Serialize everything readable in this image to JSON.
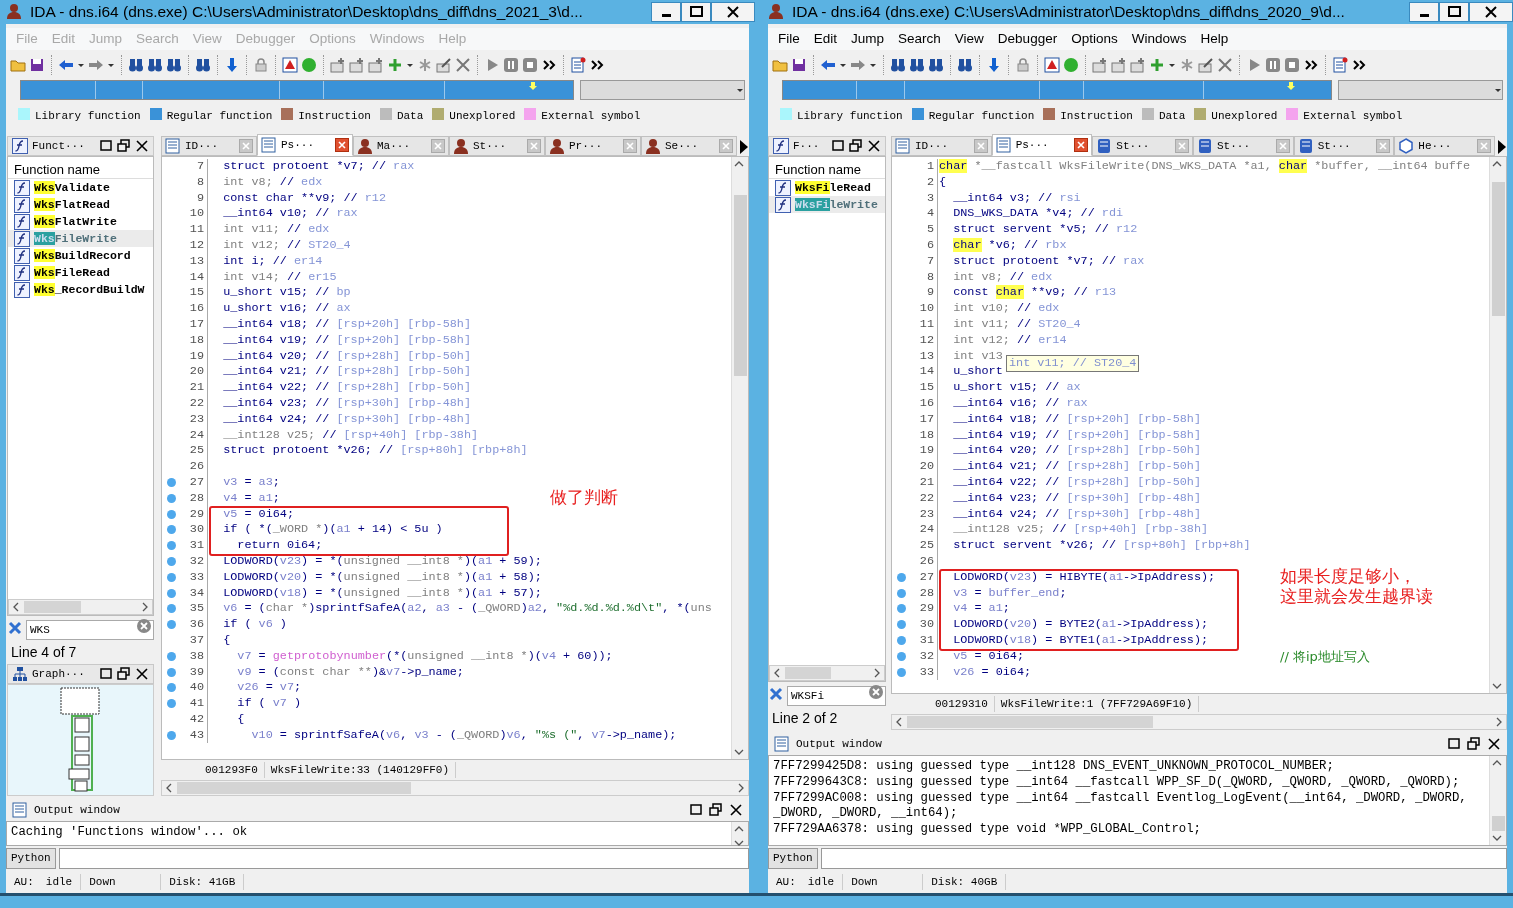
{
  "windows": [
    {
      "title": "IDA - dns.i64 (dns.exe) C:\\Users\\Administrator\\Desktop\\dns_diff\\dns_2021_3\\d...",
      "menu": [
        {
          "label": "File",
          "disabled": true
        },
        {
          "label": "Edit",
          "disabled": true
        },
        {
          "label": "Jump",
          "disabled": true
        },
        {
          "label": "Search",
          "disabled": true
        },
        {
          "label": "View",
          "disabled": true
        },
        {
          "label": "Debugger",
          "disabled": true
        },
        {
          "label": "Options",
          "disabled": true
        },
        {
          "label": "Windows",
          "disabled": true
        },
        {
          "label": "Help",
          "disabled": true
        }
      ],
      "legend": [
        {
          "label": "Library function",
          "color": "#aaf6fc"
        },
        {
          "label": "Regular function",
          "color": "#3a92d8"
        },
        {
          "label": "Instruction",
          "color": "#a8705a"
        },
        {
          "label": "Data",
          "color": "#bcbcbc"
        },
        {
          "label": "Unexplored",
          "color": "#b0ac70"
        },
        {
          "label": "External symbol",
          "color": "#f4a4ee"
        }
      ],
      "functions_panel": {
        "title": "Funct···",
        "column": "Function name",
        "filter": "WKS",
        "line_info": "Line 4 of 7",
        "items": [
          {
            "match": "Wks",
            "rest": "Validate",
            "selected": false
          },
          {
            "match": "Wks",
            "rest": "FlatRead",
            "selected": false
          },
          {
            "match": "Wks",
            "rest": "FlatWrite",
            "selected": false
          },
          {
            "match": "Wks",
            "rest": "FileWrite",
            "selected": true
          },
          {
            "match": "Wks",
            "rest": "BuildRecord",
            "selected": false
          },
          {
            "match": "Wks",
            "rest": "FileRead",
            "selected": false
          },
          {
            "match": "Wks",
            "rest": "_RecordBuildW",
            "selected": false
          }
        ]
      },
      "graph_panel": {
        "title": "Graph···"
      },
      "tabs": [
        {
          "label": "ID···",
          "kind": "listing",
          "selected": false
        },
        {
          "label": "Ps···",
          "kind": "listing",
          "selected": true
        },
        {
          "label": "Ma···",
          "kind": "portrait",
          "selected": false
        },
        {
          "label": "St···",
          "kind": "portrait",
          "selected": false
        },
        {
          "label": "Pr···",
          "kind": "portrait",
          "selected": false
        },
        {
          "label": "Se···",
          "kind": "portrait",
          "selected": false
        }
      ],
      "code": {
        "address": "001293F0",
        "location": "WksFileWrite:33 (140129FF0)",
        "lines": [
          {
            "num": "7",
            "bp": false,
            "tokens": [
              {
                "kind": "code",
                "text": "  struct protoent *v7; // "
              },
              {
                "kind": "cmt",
                "text": "rax"
              }
            ]
          },
          {
            "num": "8",
            "bp": false,
            "tokens": [
              {
                "kind": "dim",
                "text": "  int v8; "
              },
              {
                "kind": "code",
                "text": "// "
              },
              {
                "kind": "cmt",
                "text": "edx"
              }
            ]
          },
          {
            "num": "9",
            "bp": false,
            "tokens": [
              {
                "kind": "code",
                "text": "  const char **v9; // "
              },
              {
                "kind": "cmt",
                "text": "r12"
              }
            ]
          },
          {
            "num": "10",
            "bp": false,
            "tokens": [
              {
                "kind": "code",
                "text": "  __int64 v10; // "
              },
              {
                "kind": "cmt",
                "text": "rax"
              }
            ]
          },
          {
            "num": "11",
            "bp": false,
            "tokens": [
              {
                "kind": "dim",
                "text": "  int v11; "
              },
              {
                "kind": "code",
                "text": "// "
              },
              {
                "kind": "cmt",
                "text": "edx"
              }
            ]
          },
          {
            "num": "12",
            "bp": false,
            "tokens": [
              {
                "kind": "dim",
                "text": "  int v12; "
              },
              {
                "kind": "code",
                "text": "// "
              },
              {
                "kind": "cmt",
                "text": "ST20_4"
              }
            ]
          },
          {
            "num": "13",
            "bp": false,
            "tokens": [
              {
                "kind": "code",
                "text": "  int i; // "
              },
              {
                "kind": "cmt",
                "text": "er14"
              }
            ]
          },
          {
            "num": "14",
            "bp": false,
            "tokens": [
              {
                "kind": "dim",
                "text": "  int v14; "
              },
              {
                "kind": "code",
                "text": "// "
              },
              {
                "kind": "cmt",
                "text": "er15"
              }
            ]
          },
          {
            "num": "15",
            "bp": false,
            "tokens": [
              {
                "kind": "code",
                "text": "  u_short v15; // "
              },
              {
                "kind": "cmt",
                "text": "bp"
              }
            ]
          },
          {
            "num": "16",
            "bp": false,
            "tokens": [
              {
                "kind": "code",
                "text": "  u_short v16; // "
              },
              {
                "kind": "cmt",
                "text": "ax"
              }
            ]
          },
          {
            "num": "17",
            "bp": false,
            "tokens": [
              {
                "kind": "code",
                "text": "  __int64 v18; // "
              },
              {
                "kind": "cmt",
                "text": "[rsp+20h] [rbp-58h]"
              }
            ]
          },
          {
            "num": "18",
            "bp": false,
            "tokens": [
              {
                "kind": "code",
                "text": "  __int64 v19; // "
              },
              {
                "kind": "cmt",
                "text": "[rsp+20h] [rbp-58h]"
              }
            ]
          },
          {
            "num": "19",
            "bp": false,
            "tokens": [
              {
                "kind": "code",
                "text": "  __int64 v20; // "
              },
              {
                "kind": "cmt",
                "text": "[rsp+28h] [rbp-50h]"
              }
            ]
          },
          {
            "num": "20",
            "bp": false,
            "tokens": [
              {
                "kind": "code",
                "text": "  __int64 v21; // "
              },
              {
                "kind": "cmt",
                "text": "[rsp+28h] [rbp-50h]"
              }
            ]
          },
          {
            "num": "21",
            "bp": false,
            "tokens": [
              {
                "kind": "code",
                "text": "  __int64 v22; // "
              },
              {
                "kind": "cmt",
                "text": "[rsp+28h] [rbp-50h]"
              }
            ]
          },
          {
            "num": "22",
            "bp": false,
            "tokens": [
              {
                "kind": "code",
                "text": "  __int64 v23; // "
              },
              {
                "kind": "cmt",
                "text": "[rsp+30h] [rbp-48h]"
              }
            ]
          },
          {
            "num": "23",
            "bp": false,
            "tokens": [
              {
                "kind": "code",
                "text": "  __int64 v24; // "
              },
              {
                "kind": "cmt",
                "text": "[rsp+30h] [rbp-48h]"
              }
            ]
          },
          {
            "num": "24",
            "bp": false,
            "tokens": [
              {
                "kind": "dim",
                "text": "  __int128 v25; "
              },
              {
                "kind": "code",
                "text": "// "
              },
              {
                "kind": "cmt",
                "text": "[rsp+40h] [rbp-38h]"
              }
            ]
          },
          {
            "num": "25",
            "bp": false,
            "tokens": [
              {
                "kind": "code",
                "text": "  struct protoent *v26; // "
              },
              {
                "kind": "cmt",
                "text": "[rsp+80h] [rbp+8h]"
              }
            ]
          },
          {
            "num": "26",
            "bp": false
          },
          {
            "num": "27",
            "bp": true,
            "tokens": [
              {
                "kind": "var",
                "text": "  v3"
              },
              {
                "kind": "code",
                "text": " = "
              },
              {
                "kind": "var",
                "text": "a3"
              },
              {
                "kind": "code",
                "text": ";"
              }
            ]
          },
          {
            "num": "28",
            "bp": true,
            "note": {
              "kind": "callout",
              "lines": [
                "做了判断"
              ]
            },
            "tokens": [
              {
                "kind": "var",
                "text": "  v4"
              },
              {
                "kind": "code",
                "text": " = "
              },
              {
                "kind": "var",
                "text": "a1"
              },
              {
                "kind": "code",
                "text": ";"
              }
            ]
          },
          {
            "num": "29",
            "bp": true,
            "boxed": true,
            "tokens": [
              {
                "kind": "var",
                "text": "  v5"
              },
              {
                "kind": "code",
                "text": " = 0i64;"
              }
            ]
          },
          {
            "num": "30",
            "bp": true,
            "boxed": true,
            "tokens": [
              {
                "kind": "code",
                "text": "  if ( *("
              },
              {
                "kind": "dim",
                "text": "_WORD *"
              },
              {
                "kind": "code",
                "text": ")("
              },
              {
                "kind": "var",
                "text": "a1"
              },
              {
                "kind": "code",
                "text": " + 14) < 5u )"
              }
            ]
          },
          {
            "num": "31",
            "bp": true,
            "boxed": true,
            "tokens": [
              {
                "kind": "code",
                "text": "    return 0i64;"
              }
            ]
          },
          {
            "num": "32",
            "bp": true,
            "tokens": [
              {
                "kind": "code",
                "text": "  LODWORD("
              },
              {
                "kind": "var",
                "text": "v23"
              },
              {
                "kind": "code",
                "text": ") = *("
              },
              {
                "kind": "dim",
                "text": "unsigned __int8 *"
              },
              {
                "kind": "code",
                "text": ")("
              },
              {
                "kind": "var",
                "text": "a1"
              },
              {
                "kind": "code",
                "text": " + 59);"
              }
            ]
          },
          {
            "num": "33",
            "bp": true,
            "tokens": [
              {
                "kind": "code",
                "text": "  LODWORD("
              },
              {
                "kind": "var",
                "text": "v20"
              },
              {
                "kind": "code",
                "text": ") = *("
              },
              {
                "kind": "dim",
                "text": "unsigned __int8 *"
              },
              {
                "kind": "code",
                "text": ")("
              },
              {
                "kind": "var",
                "text": "a1"
              },
              {
                "kind": "code",
                "text": " + 58);"
              }
            ]
          },
          {
            "num": "34",
            "bp": true,
            "tokens": [
              {
                "kind": "code",
                "text": "  LODWORD("
              },
              {
                "kind": "var",
                "text": "v18"
              },
              {
                "kind": "code",
                "text": ") = *("
              },
              {
                "kind": "dim",
                "text": "unsigned __int8 *"
              },
              {
                "kind": "code",
                "text": ")("
              },
              {
                "kind": "var",
                "text": "a1"
              },
              {
                "kind": "code",
                "text": " + 57);"
              }
            ]
          },
          {
            "num": "35",
            "bp": true,
            "tokens": [
              {
                "kind": "var",
                "text": "  v6"
              },
              {
                "kind": "code",
                "text": " = ("
              },
              {
                "kind": "dim",
                "text": "char *"
              },
              {
                "kind": "code",
                "text": ")sprintfSafeA("
              },
              {
                "kind": "var",
                "text": "a2"
              },
              {
                "kind": "code",
                "text": ", "
              },
              {
                "kind": "var",
                "text": "a3"
              },
              {
                "kind": "code",
                "text": " - ("
              },
              {
                "kind": "dim",
                "text": "_QWORD"
              },
              {
                "kind": "code",
                "text": ")"
              },
              {
                "kind": "var",
                "text": "a2"
              },
              {
                "kind": "code",
                "text": ", "
              },
              {
                "kind": "str",
                "text": "\"%d.%d.%d.%d\\t\""
              },
              {
                "kind": "code",
                "text": ", *("
              },
              {
                "kind": "dim",
                "text": "uns"
              }
            ]
          },
          {
            "num": "36",
            "bp": true,
            "tokens": [
              {
                "kind": "code",
                "text": "  if ( "
              },
              {
                "kind": "var",
                "text": "v6"
              },
              {
                "kind": "code",
                "text": " )"
              }
            ]
          },
          {
            "num": "37",
            "bp": false,
            "tokens": [
              {
                "kind": "code",
                "text": "  {"
              }
            ]
          },
          {
            "num": "38",
            "bp": true,
            "tokens": [
              {
                "kind": "var",
                "text": "    v7"
              },
              {
                "kind": "code",
                "text": " = "
              },
              {
                "kind": "fn",
                "text": "getprotobynumber"
              },
              {
                "kind": "code",
                "text": "(*("
              },
              {
                "kind": "dim",
                "text": "unsigned __int8 *"
              },
              {
                "kind": "code",
                "text": ")("
              },
              {
                "kind": "var",
                "text": "v4"
              },
              {
                "kind": "code",
                "text": " + 60));"
              }
            ]
          },
          {
            "num": "39",
            "bp": true,
            "tokens": [
              {
                "kind": "var",
                "text": "    v9"
              },
              {
                "kind": "code",
                "text": " = ("
              },
              {
                "kind": "dim",
                "text": "const char **"
              },
              {
                "kind": "code",
                "text": ")&"
              },
              {
                "kind": "var",
                "text": "v7"
              },
              {
                "kind": "code",
                "text": "->p_name;"
              }
            ]
          },
          {
            "num": "40",
            "bp": true,
            "tokens": [
              {
                "kind": "var",
                "text": "    v26"
              },
              {
                "kind": "code",
                "text": " = "
              },
              {
                "kind": "var",
                "text": "v7"
              },
              {
                "kind": "code",
                "text": ";"
              }
            ]
          },
          {
            "num": "41",
            "bp": true,
            "tokens": [
              {
                "kind": "code",
                "text": "    if ( "
              },
              {
                "kind": "var",
                "text": "v7"
              },
              {
                "kind": "code",
                "text": " )"
              }
            ]
          },
          {
            "num": "42",
            "bp": false,
            "tokens": [
              {
                "kind": "code",
                "text": "    {"
              }
            ]
          },
          {
            "num": "43",
            "bp": true,
            "tokens": [
              {
                "kind": "var",
                "text": "      v10"
              },
              {
                "kind": "code",
                "text": " = sprintfSafeA("
              },
              {
                "kind": "var",
                "text": "v6"
              },
              {
                "kind": "code",
                "text": ", "
              },
              {
                "kind": "var",
                "text": "v3"
              },
              {
                "kind": "code",
                "text": " - ("
              },
              {
                "kind": "dim",
                "text": "_QWORD"
              },
              {
                "kind": "code",
                "text": ")"
              },
              {
                "kind": "var",
                "text": "v6"
              },
              {
                "kind": "code",
                "text": ", "
              },
              {
                "kind": "str",
                "text": "\"%s (\""
              },
              {
                "kind": "code",
                "text": ", "
              },
              {
                "kind": "var",
                "text": "v7"
              },
              {
                "kind": "code",
                "text": "->p_name);"
              }
            ]
          }
        ]
      },
      "output": {
        "title": "Output window",
        "lines": [
          "Caching 'Functions window'... ok"
        ]
      },
      "python_label": "Python",
      "status": {
        "au": "AU:",
        "state": "idle",
        "direction": "Down",
        "disk": "Disk: 41GB"
      }
    },
    {
      "title": "IDA - dns.i64 (dns.exe) C:\\Users\\Administrator\\Desktop\\dns_diff\\dns_2020_9\\d...",
      "menu": [
        {
          "label": "File",
          "disabled": false
        },
        {
          "label": "Edit",
          "disabled": false
        },
        {
          "label": "Jump",
          "disabled": false
        },
        {
          "label": "Search",
          "disabled": false
        },
        {
          "label": "View",
          "disabled": false
        },
        {
          "label": "Debugger",
          "disabled": false
        },
        {
          "label": "Options",
          "disabled": false
        },
        {
          "label": "Windows",
          "disabled": false
        },
        {
          "label": "Help",
          "disabled": false
        }
      ],
      "legend": [
        {
          "label": "Library function",
          "color": "#aaf6fc"
        },
        {
          "label": "Regular function",
          "color": "#3a92d8"
        },
        {
          "label": "Instruction",
          "color": "#a8705a"
        },
        {
          "label": "Data",
          "color": "#bcbcbc"
        },
        {
          "label": "Unexplored",
          "color": "#b0ac70"
        },
        {
          "label": "External symbol",
          "color": "#f4a4ee"
        }
      ],
      "functions_panel": {
        "title": "F···",
        "column": "Function name",
        "filter": "WKSFi",
        "line_info": "Line 2 of 2",
        "items": [
          {
            "match": "WksFi",
            "rest": "leRead",
            "selected": false
          },
          {
            "match": "WksFi",
            "rest": "leWrite",
            "selected": true
          }
        ]
      },
      "tabs": [
        {
          "label": "ID···",
          "kind": "listing",
          "selected": false
        },
        {
          "label": "Ps···",
          "kind": "listing",
          "selected": true
        },
        {
          "label": "St···",
          "kind": "struct",
          "selected": false
        },
        {
          "label": "St···",
          "kind": "struct",
          "selected": false
        },
        {
          "label": "St···",
          "kind": "struct",
          "selected": false
        },
        {
          "label": "He···",
          "kind": "hex",
          "selected": false
        }
      ],
      "code": {
        "address": "00129310",
        "location": "WksFileWrite:1 (7FF729A69F10)",
        "tooltip": "int v11; // ST20_4",
        "lines": [
          {
            "num": "1",
            "bp": false,
            "tokens": [
              {
                "kind": "hl",
                "text": "char"
              },
              {
                "kind": "dim",
                "text": " *__fastcall WksFileWrite(DNS_WKS_DATA *a1, "
              },
              {
                "kind": "hl",
                "text": "char"
              },
              {
                "kind": "dim",
                "text": " *buffer, __int64 buffe"
              }
            ]
          },
          {
            "num": "2",
            "bp": false,
            "tokens": [
              {
                "kind": "code",
                "text": "{"
              }
            ]
          },
          {
            "num": "3",
            "bp": false,
            "tokens": [
              {
                "kind": "code",
                "text": "  __int64 v3; // "
              },
              {
                "kind": "cmt",
                "text": "rsi"
              }
            ]
          },
          {
            "num": "4",
            "bp": false,
            "tokens": [
              {
                "kind": "code",
                "text": "  DNS_WKS_DATA *v4; // "
              },
              {
                "kind": "cmt",
                "text": "rdi"
              }
            ]
          },
          {
            "num": "5",
            "bp": false,
            "tokens": [
              {
                "kind": "code",
                "text": "  struct servent *v5; // "
              },
              {
                "kind": "cmt",
                "text": "r12"
              }
            ]
          },
          {
            "num": "6",
            "bp": false,
            "tokens": [
              {
                "kind": "hl",
                "text": "  char"
              },
              {
                "kind": "code",
                "text": " *v6; // "
              },
              {
                "kind": "cmt",
                "text": "rbx"
              }
            ]
          },
          {
            "num": "7",
            "bp": false,
            "tokens": [
              {
                "kind": "code",
                "text": "  struct protoent *v7; // "
              },
              {
                "kind": "cmt",
                "text": "rax"
              }
            ]
          },
          {
            "num": "8",
            "bp": false,
            "tokens": [
              {
                "kind": "dim",
                "text": "  int v8; "
              },
              {
                "kind": "code",
                "text": "// "
              },
              {
                "kind": "cmt",
                "text": "edx"
              }
            ]
          },
          {
            "num": "9",
            "bp": false,
            "tokens": [
              {
                "kind": "code",
                "text": "  const "
              },
              {
                "kind": "hl",
                "text": "char"
              },
              {
                "kind": "code",
                "text": " **v9; // "
              },
              {
                "kind": "cmt",
                "text": "r13"
              }
            ]
          },
          {
            "num": "10",
            "bp": false,
            "tokens": [
              {
                "kind": "dim",
                "text": "  int v10; "
              },
              {
                "kind": "code",
                "text": "// "
              },
              {
                "kind": "cmt",
                "text": "edx"
              }
            ]
          },
          {
            "num": "11",
            "bp": false,
            "tokens": [
              {
                "kind": "dim",
                "text": "  int v11; "
              },
              {
                "kind": "code",
                "text": "// "
              },
              {
                "kind": "cmt",
                "text": "ST20_4"
              }
            ]
          },
          {
            "num": "12",
            "bp": false,
            "tokens": [
              {
                "kind": "dim",
                "text": "  int v12; "
              },
              {
                "kind": "code",
                "text": "// "
              },
              {
                "kind": "cmt",
                "text": "er14"
              }
            ]
          },
          {
            "num": "13",
            "bp": false,
            "tokens": [
              {
                "kind": "dim",
                "text": "  int v13"
              }
            ]
          },
          {
            "num": "14",
            "bp": false,
            "tokens": [
              {
                "kind": "code",
                "text": "  u_short"
              }
            ]
          },
          {
            "num": "15",
            "bp": false,
            "tokens": [
              {
                "kind": "code",
                "text": "  u_short v15; // "
              },
              {
                "kind": "cmt",
                "text": "ax"
              }
            ]
          },
          {
            "num": "16",
            "bp": false,
            "tokens": [
              {
                "kind": "code",
                "text": "  __int64 v16; // "
              },
              {
                "kind": "cmt",
                "text": "rax"
              }
            ]
          },
          {
            "num": "17",
            "bp": false,
            "tokens": [
              {
                "kind": "code",
                "text": "  __int64 v18; // "
              },
              {
                "kind": "cmt",
                "text": "[rsp+20h] [rbp-58h]"
              }
            ]
          },
          {
            "num": "18",
            "bp": false,
            "tokens": [
              {
                "kind": "code",
                "text": "  __int64 v19; // "
              },
              {
                "kind": "cmt",
                "text": "[rsp+20h] [rbp-58h]"
              }
            ]
          },
          {
            "num": "19",
            "bp": false,
            "tokens": [
              {
                "kind": "code",
                "text": "  __int64 v20; // "
              },
              {
                "kind": "cmt",
                "text": "[rsp+28h] [rbp-50h]"
              }
            ]
          },
          {
            "num": "20",
            "bp": false,
            "tokens": [
              {
                "kind": "code",
                "text": "  __int64 v21; // "
              },
              {
                "kind": "cmt",
                "text": "[rsp+28h] [rbp-50h]"
              }
            ]
          },
          {
            "num": "21",
            "bp": false,
            "tokens": [
              {
                "kind": "code",
                "text": "  __int64 v22; // "
              },
              {
                "kind": "cmt",
                "text": "[rsp+28h] [rbp-50h]"
              }
            ]
          },
          {
            "num": "22",
            "bp": false,
            "tokens": [
              {
                "kind": "code",
                "text": "  __int64 v23; // "
              },
              {
                "kind": "cmt",
                "text": "[rsp+30h] [rbp-48h]"
              }
            ]
          },
          {
            "num": "23",
            "bp": false,
            "tokens": [
              {
                "kind": "code",
                "text": "  __int64 v24; // "
              },
              {
                "kind": "cmt",
                "text": "[rsp+30h] [rbp-48h]"
              }
            ]
          },
          {
            "num": "24",
            "bp": false,
            "tokens": [
              {
                "kind": "dim",
                "text": "  __int128 v25; "
              },
              {
                "kind": "code",
                "text": "// "
              },
              {
                "kind": "cmt",
                "text": "[rsp+40h] [rbp-38h]"
              }
            ]
          },
          {
            "num": "25",
            "bp": false,
            "tokens": [
              {
                "kind": "code",
                "text": "  struct servent *v26; // "
              },
              {
                "kind": "cmt",
                "text": "[rsp+80h] [rbp+8h]"
              }
            ]
          },
          {
            "num": "26",
            "bp": false
          },
          {
            "num": "27",
            "bp": true,
            "boxed": true,
            "note": {
              "kind": "callout",
              "lines": [
                "如果长度足够小，",
                "这里就会发生越界读"
              ]
            },
            "tokens": [
              {
                "kind": "code",
                "text": "  LODWORD("
              },
              {
                "kind": "var",
                "text": "v23"
              },
              {
                "kind": "code",
                "text": ") = HIBYTE("
              },
              {
                "kind": "var",
                "text": "a1"
              },
              {
                "kind": "code",
                "text": "->IpAddress);"
              }
            ]
          },
          {
            "num": "28",
            "bp": true,
            "boxed": true,
            "tokens": [
              {
                "kind": "var",
                "text": "  v3"
              },
              {
                "kind": "code",
                "text": " = "
              },
              {
                "kind": "var",
                "text": "buffer_end"
              },
              {
                "kind": "code",
                "text": ";"
              }
            ]
          },
          {
            "num": "29",
            "bp": true,
            "boxed": true,
            "tokens": [
              {
                "kind": "var",
                "text": "  v4"
              },
              {
                "kind": "code",
                "text": " = "
              },
              {
                "kind": "var",
                "text": "a1"
              },
              {
                "kind": "code",
                "text": ";"
              }
            ]
          },
          {
            "num": "30",
            "bp": true,
            "boxed": true,
            "tokens": [
              {
                "kind": "code",
                "text": "  LODWORD("
              },
              {
                "kind": "var",
                "text": "v20"
              },
              {
                "kind": "code",
                "text": ") = BYTE2("
              },
              {
                "kind": "var",
                "text": "a1"
              },
              {
                "kind": "code",
                "text": "->IpAddress);"
              }
            ]
          },
          {
            "num": "31",
            "bp": true,
            "boxed": true,
            "tokens": [
              {
                "kind": "code",
                "text": "  LODWORD("
              },
              {
                "kind": "var",
                "text": "v18"
              },
              {
                "kind": "code",
                "text": ") = BYTE1("
              },
              {
                "kind": "var",
                "text": "a1"
              },
              {
                "kind": "code",
                "text": "->IpAddress);"
              }
            ]
          },
          {
            "num": "32",
            "bp": true,
            "note": {
              "kind": "comment",
              "lines": [
                "// 将ip地址写入"
              ]
            },
            "tokens": [
              {
                "kind": "var",
                "text": "  v5"
              },
              {
                "kind": "code",
                "text": " = 0i64;"
              }
            ]
          },
          {
            "num": "33",
            "bp": true,
            "tokens": [
              {
                "kind": "var",
                "text": "  v26"
              },
              {
                "kind": "code",
                "text": " = 0i64;"
              }
            ]
          }
        ]
      },
      "output": {
        "title": "Output window",
        "lines": [
          "7FF7299425D8: using guessed type __int128 DNS_EVENT_UNKNOWN_PROTOCOL_NUMBER;",
          "7FF7299643C8: using guessed type __int64 __fastcall WPP_SF_D(_QWORD, _QWORD, _QWORD, _QWORD);",
          "7FF7299AC008: using guessed type __int64 __fastcall Eventlog_LogEvent(__int64, _DWORD, _DWORD,",
          "_DWORD, _DWORD, __int64);",
          "7FF729AA6378: using guessed type void *WPP_GLOBAL_Control;"
        ]
      },
      "python_label": "Python",
      "status": {
        "au": "AU:",
        "state": "idle",
        "direction": "Down",
        "disk": "Disk: 40GB"
      }
    }
  ]
}
